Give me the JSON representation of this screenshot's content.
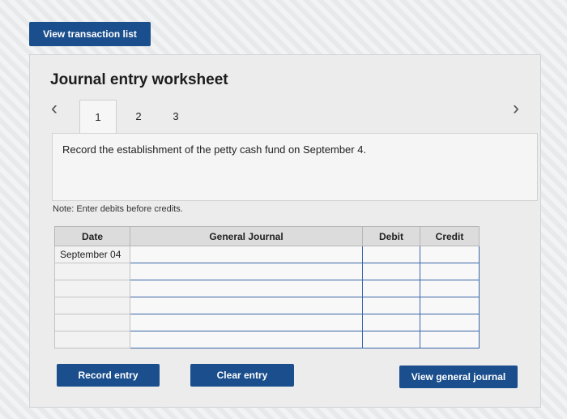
{
  "top": {
    "view_transactions_label": "View transaction list"
  },
  "worksheet": {
    "title": "Journal entry worksheet",
    "tabs": [
      "1",
      "2",
      "3"
    ],
    "instruction": "Record the establishment of the petty cash fund on September 4.",
    "note": "Note: Enter debits before credits."
  },
  "table": {
    "headers": {
      "date": "Date",
      "journal": "General Journal",
      "debit": "Debit",
      "credit": "Credit"
    },
    "rows": [
      {
        "date": "September 04",
        "account": "",
        "debit": "",
        "credit": ""
      },
      {
        "date": "",
        "account": "",
        "debit": "",
        "credit": ""
      },
      {
        "date": "",
        "account": "",
        "debit": "",
        "credit": ""
      },
      {
        "date": "",
        "account": "",
        "debit": "",
        "credit": ""
      },
      {
        "date": "",
        "account": "",
        "debit": "",
        "credit": ""
      },
      {
        "date": "",
        "account": "",
        "debit": "",
        "credit": ""
      }
    ]
  },
  "buttons": {
    "record": "Record entry",
    "clear": "Clear entry",
    "view_general_journal": "View general journal"
  },
  "colors": {
    "button_blue": "#1a4e8c",
    "input_border": "#3a67a8"
  }
}
